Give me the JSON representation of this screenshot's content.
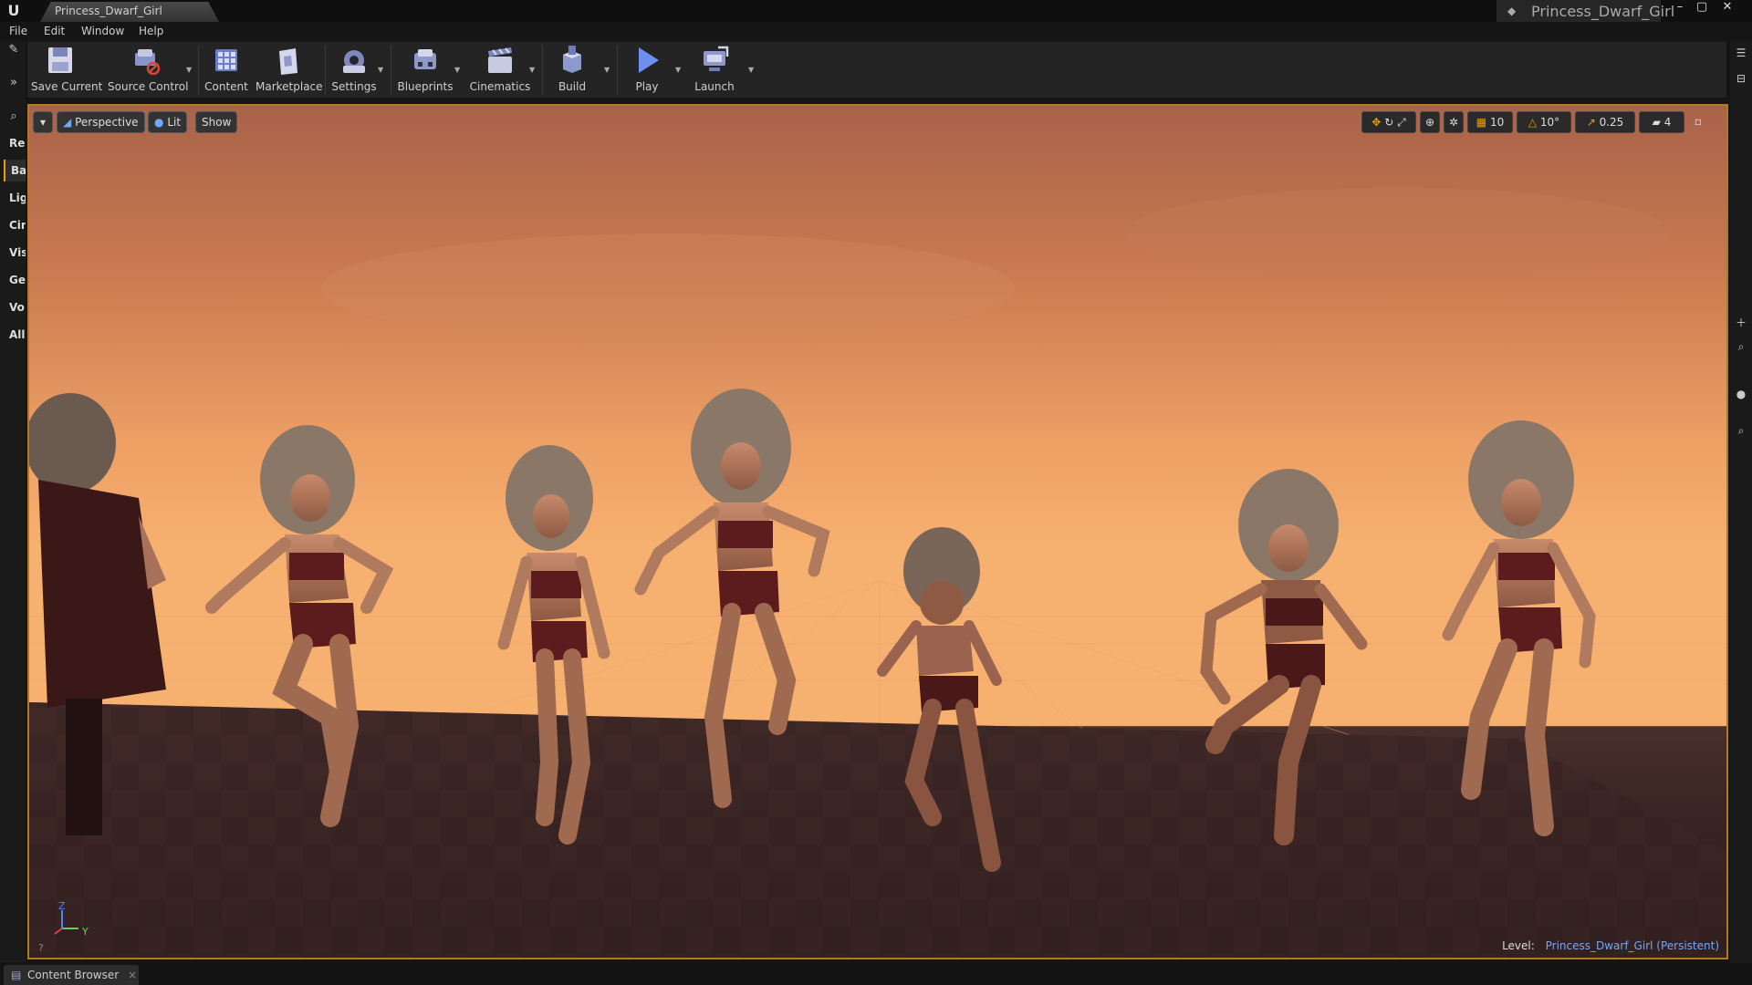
{
  "window": {
    "document_tab": "Princess_Dwarf_Girl",
    "project_name": "Princess_Dwarf_Girl",
    "buttons": [
      "minimize",
      "maximize",
      "close"
    ]
  },
  "menu": [
    "File",
    "Edit",
    "Window",
    "Help"
  ],
  "modes_panel": {
    "tabs": [
      "Re",
      "Ba",
      "Lig",
      "Cin",
      "Vis",
      "Ge",
      "Vo",
      "All"
    ],
    "active_tab": "Ba"
  },
  "toolbar": {
    "buttons": [
      {
        "label": "Save Current",
        "icon": "save-icon"
      },
      {
        "label": "Source Control",
        "icon": "source-control-icon"
      },
      {
        "label": "Content",
        "icon": "content-icon"
      },
      {
        "label": "Marketplace",
        "icon": "marketplace-icon"
      },
      {
        "label": "Settings",
        "icon": "settings-icon"
      },
      {
        "label": "Blueprints",
        "icon": "blueprints-icon"
      },
      {
        "label": "Cinematics",
        "icon": "cinematics-icon"
      },
      {
        "label": "Build",
        "icon": "build-icon"
      },
      {
        "label": "Play",
        "icon": "play-icon"
      },
      {
        "label": "Launch",
        "icon": "launch-icon"
      }
    ]
  },
  "viewport": {
    "view_mode": "Perspective",
    "lighting": "Lit",
    "show": "Show",
    "grid_snap": "10",
    "rotation_snap": "10°",
    "scale_snap": "0.25",
    "camera_speed": "4",
    "level_label": "Level:",
    "level_name": "Princess_Dwarf_Girl (Persistent)",
    "axis_y": "Y",
    "axis_z": "Z"
  },
  "bottom": {
    "content_browser_tab": "Content Browser"
  },
  "colors": {
    "viewport_border": "#b07a20",
    "level_link": "#6fa8ff",
    "active_accent": "#e8a000",
    "sky_orange": "#f3aa6e"
  }
}
